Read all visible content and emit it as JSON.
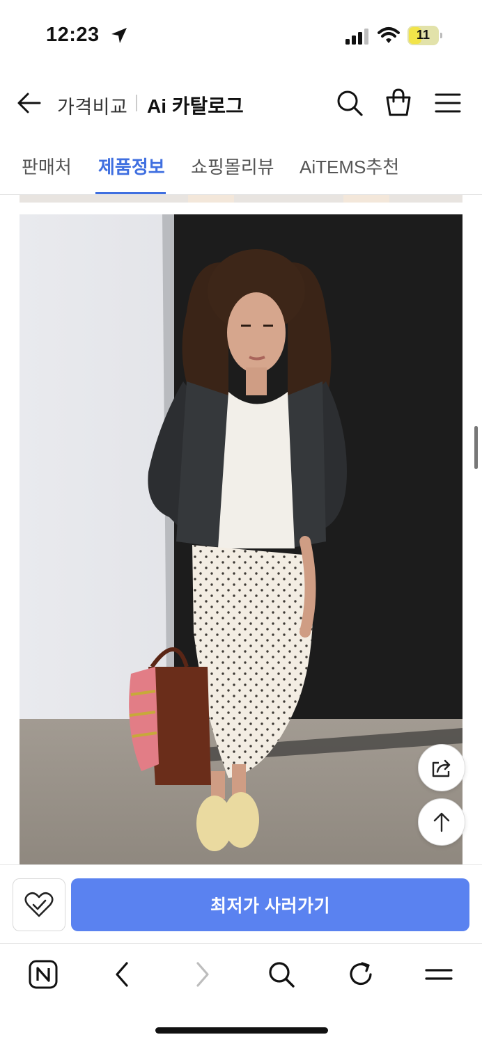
{
  "status_bar": {
    "time": "12:23",
    "battery_level": "11"
  },
  "header": {
    "title": "가격비교",
    "brand_ai": "Ai",
    "brand_name": "카탈로그"
  },
  "tabs": [
    {
      "label": "판매처",
      "active": false
    },
    {
      "label": "제품정보",
      "active": true
    },
    {
      "label": "쇼핑몰리뷰",
      "active": false
    },
    {
      "label": "AiTEMS추천",
      "active": false
    }
  ],
  "product_image": {
    "description_icon": "product-photo"
  },
  "action_bar": {
    "buy_label": "최저가 사러가기"
  },
  "colors": {
    "accent": "#3f6fe0",
    "buy_button": "#5a82f0"
  }
}
